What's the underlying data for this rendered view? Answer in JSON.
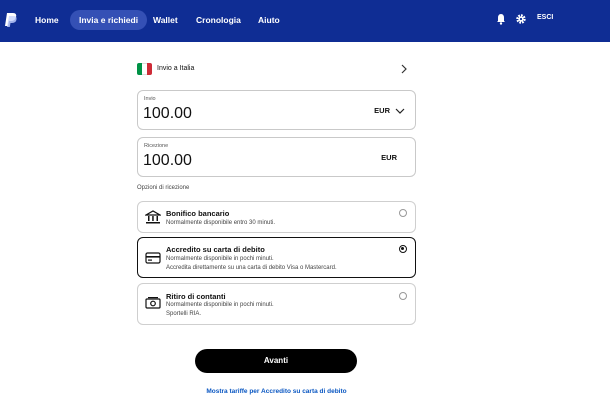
{
  "nav": {
    "items": [
      {
        "label": "Home"
      },
      {
        "label": "Invia e richiedi"
      },
      {
        "label": "Wallet"
      },
      {
        "label": "Cronologia"
      },
      {
        "label": "Aiuto"
      }
    ],
    "active": "Invia e richiedi",
    "logout_label": "ESCI",
    "icons": [
      "paypal-logo",
      "bell-icon",
      "gear-icon"
    ]
  },
  "destination": {
    "label": "Invio a Italia",
    "flag_colors": [
      "#009246",
      "#ffffff",
      "#ce2b37"
    ]
  },
  "send": {
    "label": "Invio",
    "amount": "100.00",
    "currency": "EUR"
  },
  "receive": {
    "label": "Ricezione",
    "amount": "100.00",
    "currency": "EUR"
  },
  "receive_options": {
    "title": "Opzioni di ricezione",
    "options": [
      {
        "title": "Bonifico bancario",
        "lines": [
          "Normalmente disponibile entro 30 minuti."
        ],
        "icon": "bank-icon",
        "selected": false
      },
      {
        "title": "Accredito su carta di debito",
        "lines": [
          "Normalmente disponibile in pochi minuti.",
          "Accredita direttamente su una carta di debito Visa o Mastercard."
        ],
        "icon": "card-icon",
        "selected": true
      },
      {
        "title": "Ritiro di contanti",
        "lines": [
          "Normalmente disponibile in pochi minuti.",
          "Sportelli RIA."
        ],
        "icon": "cash-icon",
        "selected": false
      }
    ]
  },
  "actions": {
    "next_label": "Avanti",
    "fees_link": "Mostra tariffe per Accredito su carta di debito"
  },
  "colors": {
    "header_bg": "#0f2d94",
    "active_tab_bg": "#3450b5",
    "link": "#0a57c2",
    "primary_button": "#000000"
  }
}
